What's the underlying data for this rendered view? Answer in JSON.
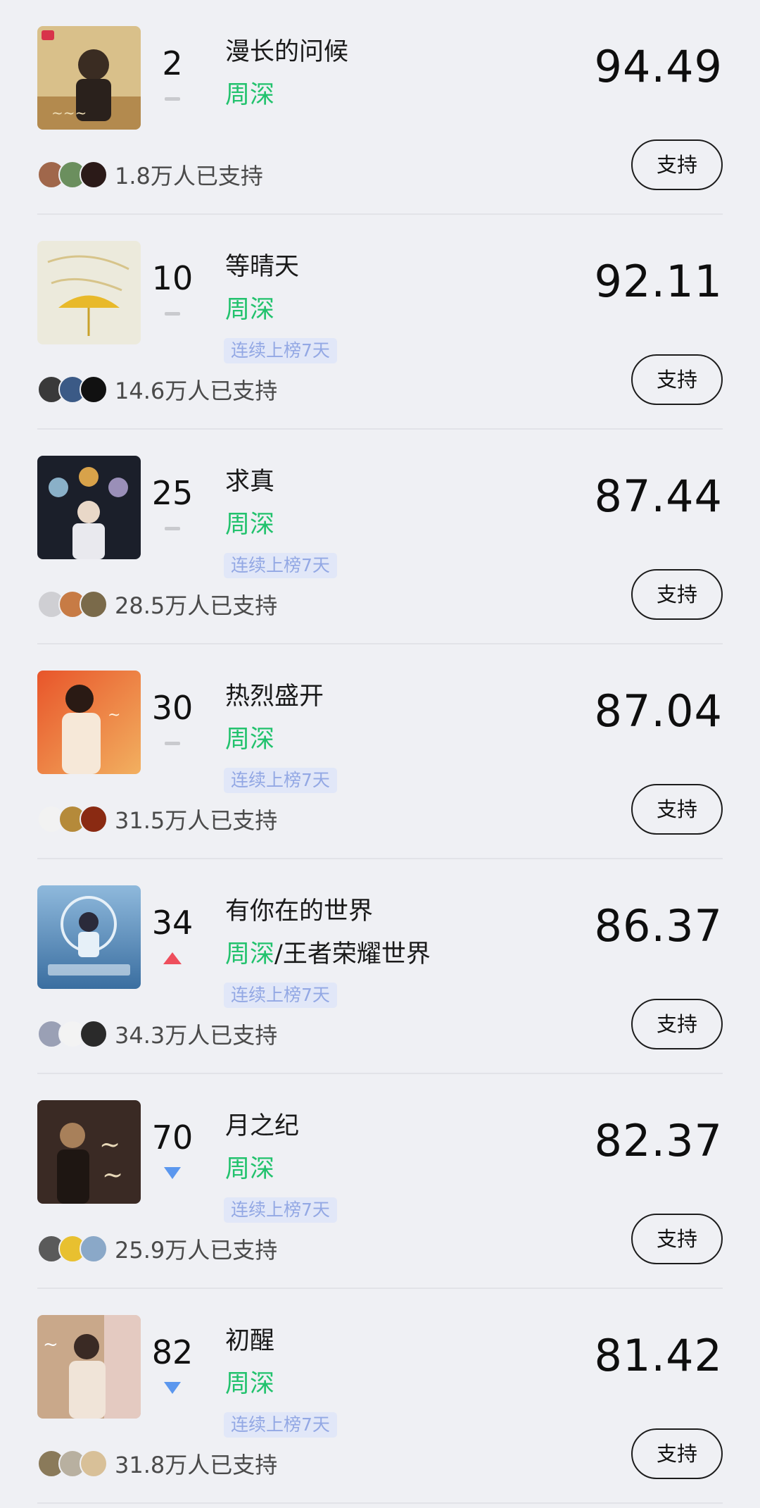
{
  "entries": [
    {
      "rank": "2",
      "trend": "same",
      "title": "漫长的问候",
      "artist": "周深",
      "extra_artist": "",
      "streak": "",
      "score": "94.49",
      "supporters": "1.8万人已支持",
      "button": "支持",
      "cover_colors": [
        "#d9c08a",
        "#3a2c22",
        "#f0e0b8"
      ],
      "avatar_colors": [
        "#a0674b",
        "#6b8f5e",
        "#2b1a18"
      ]
    },
    {
      "rank": "10",
      "trend": "same",
      "title": "等晴天",
      "artist": "周深",
      "extra_artist": "",
      "streak": "连续上榜7天",
      "score": "92.11",
      "supporters": "14.6万人已支持",
      "button": "支持",
      "cover_colors": [
        "#eceadc",
        "#e8b92a",
        "#c9b27a"
      ],
      "avatar_colors": [
        "#3a3a3a",
        "#3b5a86",
        "#111111"
      ]
    },
    {
      "rank": "25",
      "trend": "same",
      "title": "求真",
      "artist": "周深",
      "extra_artist": "",
      "streak": "连续上榜7天",
      "score": "87.44",
      "supporters": "28.5万人已支持",
      "button": "支持",
      "cover_colors": [
        "#1b1f2a",
        "#d8a24a",
        "#e9e9ee"
      ],
      "avatar_colors": [
        "#cfcfd3",
        "#c77b45",
        "#7a6a4a"
      ]
    },
    {
      "rank": "30",
      "trend": "same",
      "title": "热烈盛开",
      "artist": "周深",
      "extra_artist": "",
      "streak": "连续上榜7天",
      "score": "87.04",
      "supporters": "31.5万人已支持",
      "button": "支持",
      "cover_colors": [
        "#e8552a",
        "#f2b060",
        "#f6e8d8"
      ],
      "avatar_colors": [
        "#f2f2f2",
        "#b58a3a",
        "#8a2a12"
      ]
    },
    {
      "rank": "34",
      "trend": "up",
      "title": "有你在的世界",
      "artist": "周深",
      "extra_artist": "王者荣耀世界",
      "streak": "连续上榜7天",
      "score": "86.37",
      "supporters": "34.3万人已支持",
      "button": "支持",
      "cover_colors": [
        "#8fb9dc",
        "#e6f0f8",
        "#3a6ea0"
      ],
      "avatar_colors": [
        "#9aa0b5",
        "#f3f3f3",
        "#2a2a2a"
      ]
    },
    {
      "rank": "70",
      "trend": "down",
      "title": "月之纪",
      "artist": "周深",
      "extra_artist": "",
      "streak": "连续上榜7天",
      "score": "82.37",
      "supporters": "25.9万人已支持",
      "button": "支持",
      "cover_colors": [
        "#3a2a24",
        "#a8805a",
        "#e8d8b8"
      ],
      "avatar_colors": [
        "#5a5a5a",
        "#e8c030",
        "#8aa8c8"
      ]
    },
    {
      "rank": "82",
      "trend": "down",
      "title": "初醒",
      "artist": "周深",
      "extra_artist": "",
      "streak": "连续上榜7天",
      "score": "81.42",
      "supporters": "31.8万人已支持",
      "button": "支持",
      "cover_colors": [
        "#c9a88a",
        "#f0e4d8",
        "#7a5a4a"
      ],
      "avatar_colors": [
        "#8a7a5a",
        "#b8b0a0",
        "#d8c098"
      ]
    }
  ]
}
